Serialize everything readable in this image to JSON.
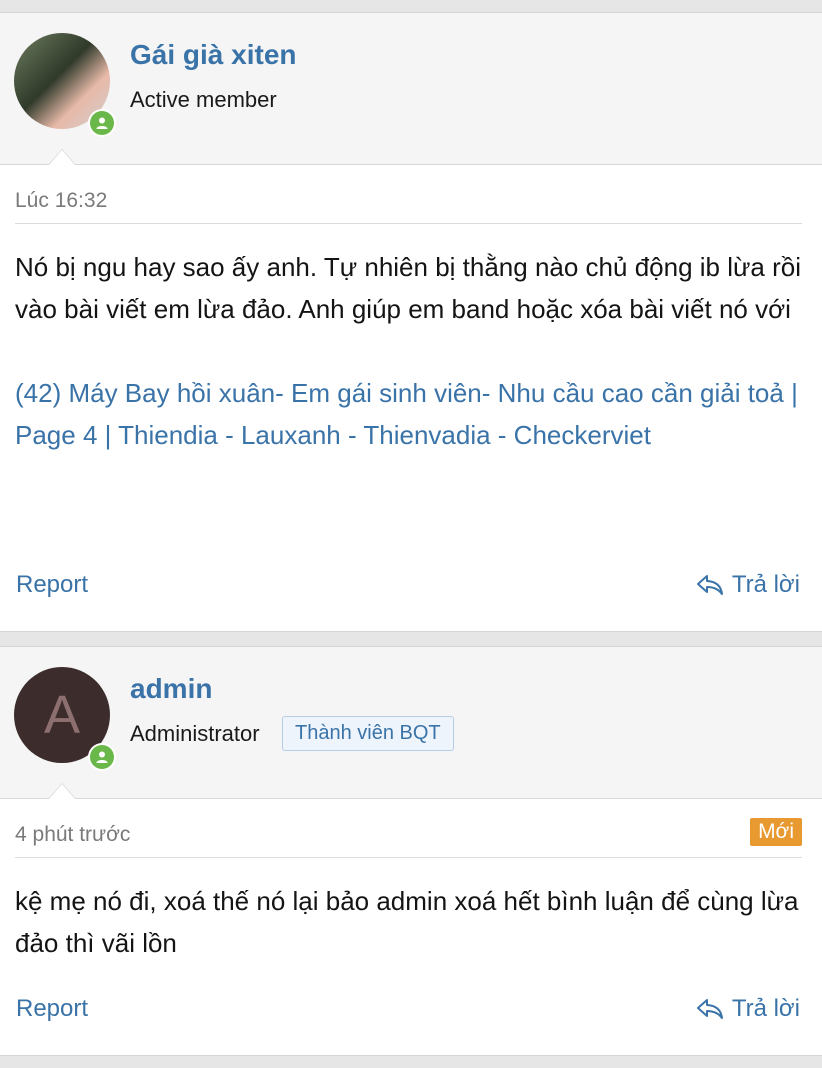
{
  "posts": [
    {
      "author": "Gái già xiten",
      "user_title": "Active member",
      "time": "Lúc 16:32",
      "body": "Nó bị ngu hay sao ấy anh. Tự nhiên bị thằng nào chủ động ib lừa rồi vào bài viết em lừa đảo. Anh giúp em band hoặc xóa bài viết nó với",
      "link_text": "(42) Máy Bay hồi xuân- Em gái sinh viên- Nhu cầu cao cần giải toả | Page 4 | Thiendia - Lauxanh - Thienvadia - Checkerviet",
      "report_label": "Report",
      "reply_label": "Trả lời"
    },
    {
      "author": "admin",
      "avatar_letter": "A",
      "user_title": "Administrator",
      "user_banner": "Thành viên BQT",
      "time": "4 phút trước",
      "new_badge": "Mới",
      "body": "kệ mẹ nó đi, xoá thế nó lại bảo admin xoá hết bình luận để cùng lừa đảo thì vãi lồn",
      "report_label": "Report",
      "reply_label": "Trả lời"
    }
  ],
  "colors": {
    "link": "#3a73a8",
    "online": "#6bb84a",
    "new_badge": "#e89a31"
  }
}
